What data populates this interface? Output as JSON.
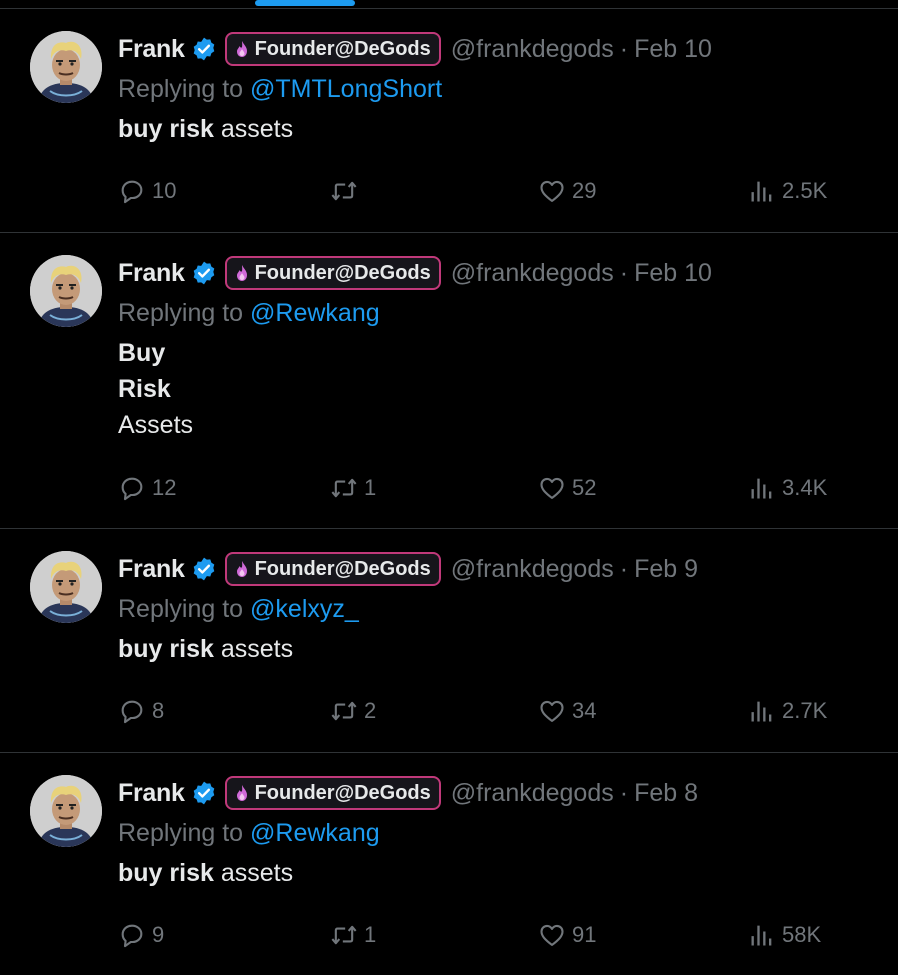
{
  "colors": {
    "background": "#000000",
    "accent": "#1d9bf0",
    "muted": "#71767b",
    "text": "#e7e9ea",
    "badge_border": "#c0397a"
  },
  "icons": {
    "verified": "verified-badge-icon",
    "reply": "reply-icon",
    "retweet": "retweet-icon",
    "like": "heart-icon",
    "views": "views-chart-icon",
    "flame": "flame-icon"
  },
  "tweets": [
    {
      "name": "Frank",
      "badge": "Founder@DeGods",
      "handle": "@frankdegods",
      "separator": "·",
      "date": "Feb 10",
      "replying_prefix": "Replying to ",
      "replying_to": "@TMTLongShort",
      "text_bold": "buy risk",
      "text_rest": " assets",
      "replies": "10",
      "retweets": "",
      "likes": "29",
      "views": "2.5K"
    },
    {
      "name": "Frank",
      "badge": "Founder@DeGods",
      "handle": "@frankdegods",
      "separator": "·",
      "date": "Feb 10",
      "replying_prefix": "Replying to ",
      "replying_to": "@Rewkang",
      "line1": "Buy",
      "line2": "Risk",
      "line3": "Assets",
      "replies": "12",
      "retweets": "1",
      "likes": "52",
      "views": "3.4K"
    },
    {
      "name": "Frank",
      "badge": "Founder@DeGods",
      "handle": "@frankdegods",
      "separator": "·",
      "date": "Feb 9",
      "replying_prefix": "Replying to ",
      "replying_to": "@kelxyz_",
      "text_bold": "buy risk",
      "text_rest": " assets",
      "replies": "8",
      "retweets": "2",
      "likes": "34",
      "views": "2.7K"
    },
    {
      "name": "Frank",
      "badge": "Founder@DeGods",
      "handle": "@frankdegods",
      "separator": "·",
      "date": "Feb 8",
      "replying_prefix": "Replying to ",
      "replying_to": "@Rewkang",
      "text_bold": "buy risk",
      "text_rest": " assets",
      "replies": "9",
      "retweets": "1",
      "likes": "91",
      "views": "58K"
    }
  ]
}
